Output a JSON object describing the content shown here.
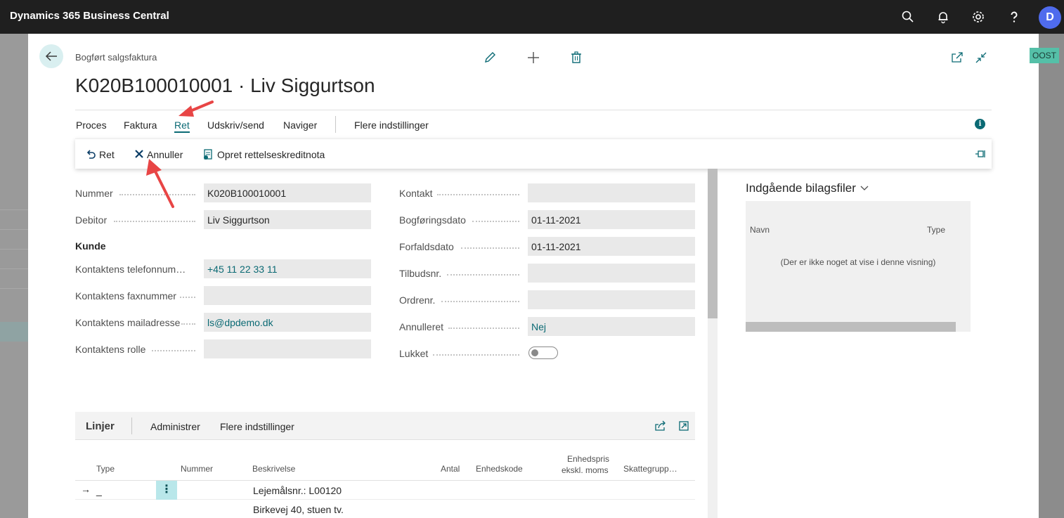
{
  "app": {
    "title": "Dynamics 365 Business Central",
    "user_initial": "D"
  },
  "side_badge": "OOST",
  "page": {
    "caption": "Bogført salgsfaktura",
    "title": "K020B100010001 · Liv Siggurtson"
  },
  "tabs": [
    "Proces",
    "Faktura",
    "Ret",
    "Udskriv/send",
    "Naviger",
    "Flere indstillinger"
  ],
  "active_tab": "Ret",
  "info_icon_letter": "i",
  "actions": [
    "Ret",
    "Annuller",
    "Opret rettelseskreditnota"
  ],
  "fields_left": [
    {
      "label": "Nummer",
      "value": "K020B100010001",
      "link": false
    },
    {
      "label": "Debitor",
      "value": "Liv Siggurtson",
      "link": false
    }
  ],
  "group_heading": "Kunde",
  "fields_contact": [
    {
      "label": "Kontaktens telefonnum…",
      "value": "+45 11 22 33 11",
      "link": true
    },
    {
      "label": "Kontaktens faxnummer",
      "value": "",
      "link": false
    },
    {
      "label": "Kontaktens mailadresse",
      "value": "ls@dpdemo.dk",
      "link": true
    },
    {
      "label": "Kontaktens rolle",
      "value": "",
      "link": false
    }
  ],
  "fields_right": [
    {
      "label": "Kontakt",
      "value": "",
      "link": false
    },
    {
      "label": "Bogføringsdato",
      "value": "01-11-2021",
      "link": false
    },
    {
      "label": "Forfaldsdato",
      "value": "01-11-2021",
      "link": false
    },
    {
      "label": "Tilbudsnr.",
      "value": "",
      "link": false
    },
    {
      "label": "Ordrenr.",
      "value": "",
      "link": false
    },
    {
      "label": "Annulleret",
      "value": "Nej",
      "link": true
    }
  ],
  "lukket": {
    "label": "Lukket",
    "value": false
  },
  "factbox": {
    "title": "Indgående bilagsfiler",
    "columns": [
      "Navn",
      "Type"
    ],
    "empty_text": "(Der er ikke noget at vise i denne visning)"
  },
  "lines": {
    "title": "Linjer",
    "toolbar": [
      "Administrer",
      "Flere indstillinger"
    ],
    "columns": {
      "type": "Type",
      "nummer": "Nummer",
      "beskrivelse": "Beskrivelse",
      "antal": "Antal",
      "enhedskode": "Enhedskode",
      "enhedspris_1": "Enhedspris",
      "enhedspris_2": "ekskl. moms",
      "skattegruppe": "Skattegrupp…"
    },
    "rows": [
      {
        "arrow": "→",
        "type": "_",
        "menu": "⋮",
        "beskrivelse": "Lejemålsnr.: L00120"
      },
      {
        "beskrivelse": "Birkevej 40, stuen tv."
      }
    ]
  },
  "colors": {
    "accent": "#0b6a74",
    "topbar": "#1f1f1f",
    "annotation": "#e84545"
  }
}
